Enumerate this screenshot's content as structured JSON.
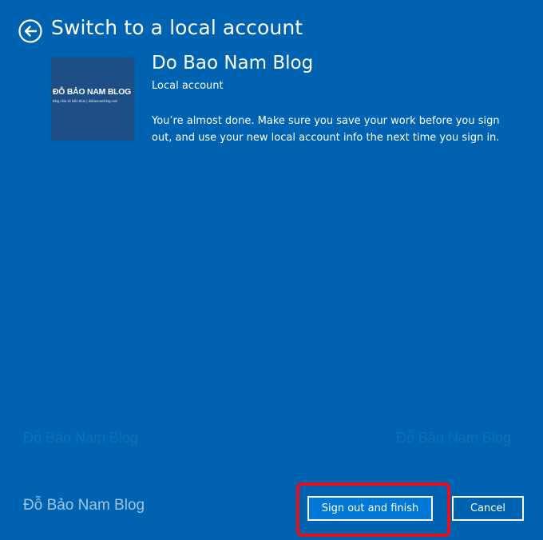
{
  "header": {
    "back_icon": "back-arrow-icon",
    "title": "Switch to a local account"
  },
  "account": {
    "avatar_logo_prefix": "ĐỖ BẢO NAM",
    "avatar_logo_suffix": "BLOG",
    "avatar_tagline": "Blog chia sẻ kiến thức | dobaonamblog.com",
    "name": "Do Bao Nam Blog",
    "type": "Local account"
  },
  "message": "You’re almost done. Make sure you save your work before you sign out, and use your new local account info the next time you sign in.",
  "watermarks": {
    "left": "Đỗ Bảo Nam Blog",
    "right": "Đỗ Bảo Nam Blog"
  },
  "footer": {
    "brand": "Đỗ Bảo Nam Blog",
    "primary_button": "Sign out and finish",
    "cancel_button": "Cancel"
  },
  "colors": {
    "background": "#0063b1",
    "primary_button": "#0078d7",
    "highlight": "#e8101d"
  }
}
